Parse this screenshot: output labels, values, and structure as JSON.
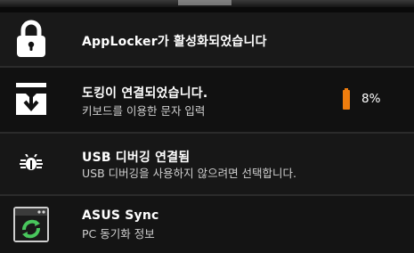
{
  "notifications": [
    {
      "icon": "padlock-icon",
      "title": "AppLocker가 활성화되었습니다"
    },
    {
      "icon": "download-tray-icon",
      "title": "도킹이 연결되었습니다.",
      "subtitle": "키보드를 이용한 문자 입력",
      "battery_percent": "8%",
      "battery_color": "#f07d0d"
    },
    {
      "icon": "bug-icon",
      "title": "USB 디버깅 연결됨",
      "subtitle": "USB 디버깅을 사용하지 않으려면 선택합니다."
    },
    {
      "icon": "sync-window-icon",
      "title": "ASUS Sync",
      "subtitle": "PC 동기화 정보"
    }
  ],
  "colors": {
    "background": "#0a0a0a",
    "title": "#ffffff",
    "subtitle": "#cfcfcf",
    "accent_battery": "#f07d0d"
  }
}
